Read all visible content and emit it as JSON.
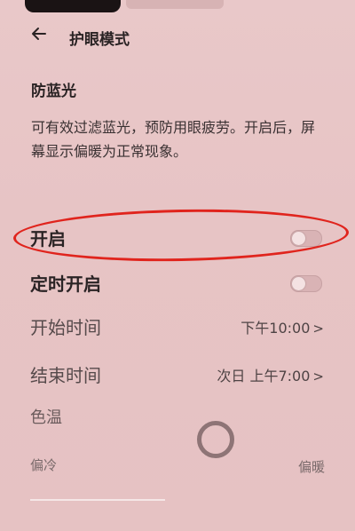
{
  "header": {
    "back_icon": "arrow-left-icon",
    "title": "护眼模式"
  },
  "section": {
    "title": "防蓝光",
    "description": "可有效过滤蓝光，预防用眼疲劳。开启后，屏幕显示偏暖为正常现象。"
  },
  "rows": {
    "enable": {
      "label": "开启",
      "state": "off"
    },
    "scheduled": {
      "label": "定时开启",
      "state": "off"
    },
    "start_time": {
      "label": "开始时间",
      "value": "下午10:00",
      "chevron": ">"
    },
    "end_time": {
      "label": "结束时间",
      "value": "次日 上午7:00",
      "chevron": ">"
    }
  },
  "color_temperature": {
    "label": "色温",
    "cool_label": "偏冷",
    "warm_label": "偏暖"
  },
  "colors": {
    "background": "#e7c4c5",
    "annotation_red": "#e0241d",
    "toggle_track": "#d9b3b5"
  }
}
